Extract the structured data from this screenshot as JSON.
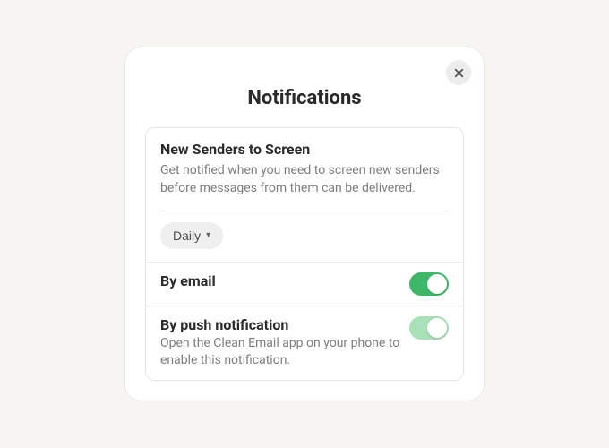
{
  "title": "Notifications",
  "section": {
    "heading": "New Senders to Screen",
    "description": "Get notified when you need to screen new senders before messages from them can be delivered.",
    "frequency_label": "Daily"
  },
  "toggles": {
    "email": {
      "label": "By email",
      "description": "",
      "on": true,
      "faded": false
    },
    "push": {
      "label": "By push notification",
      "description": "Open the Clean Email app on your phone to enable this notification.",
      "on": true,
      "faded": true
    }
  }
}
